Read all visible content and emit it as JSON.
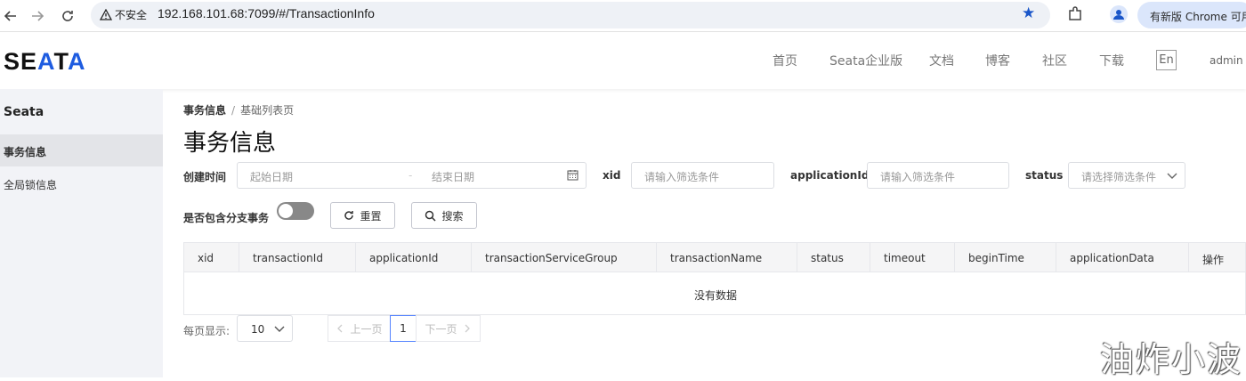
{
  "browser": {
    "security_label": "不安全",
    "url": "192.168.101.68:7099/#/TransactionInfo",
    "update_label": "有新版 Chrome 可用"
  },
  "header": {
    "logo": "SEATA",
    "nav": [
      "首页",
      "Seata企业版",
      "文档",
      "博客",
      "社区",
      "下载"
    ],
    "lang": "En",
    "user": "admin"
  },
  "sidebar": {
    "title": "Seata",
    "items": [
      {
        "label": "事务信息",
        "active": true
      },
      {
        "label": "全局锁信息",
        "active": false
      }
    ]
  },
  "breadcrumb": {
    "current": "事务信息",
    "sep": "/",
    "page": "基础列表页"
  },
  "page_title": "事务信息",
  "filters": {
    "created_label": "创建时间",
    "start_placeholder": "起始日期",
    "date_sep": "-",
    "end_placeholder": "结束日期",
    "xid_label": "xid",
    "xid_placeholder": "请输入筛选条件",
    "app_label": "applicationId",
    "app_placeholder": "请输入筛选条件",
    "status_label": "status",
    "status_placeholder": "请选择筛选条件",
    "branch_label": "是否包含分支事务",
    "branch_on": false,
    "reset_label": "重置",
    "search_label": "搜索"
  },
  "table": {
    "columns": [
      "xid",
      "transactionId",
      "applicationId",
      "transactionServiceGroup",
      "transactionName",
      "status",
      "timeout",
      "beginTime",
      "applicationData",
      "操作"
    ],
    "empty_text": "没有数据"
  },
  "pagination": {
    "page_size_label": "每页显示:",
    "page_size": "10",
    "prev_label": "上一页",
    "current_page": "1",
    "next_label": "下一页"
  },
  "watermark": "油炸小波"
}
